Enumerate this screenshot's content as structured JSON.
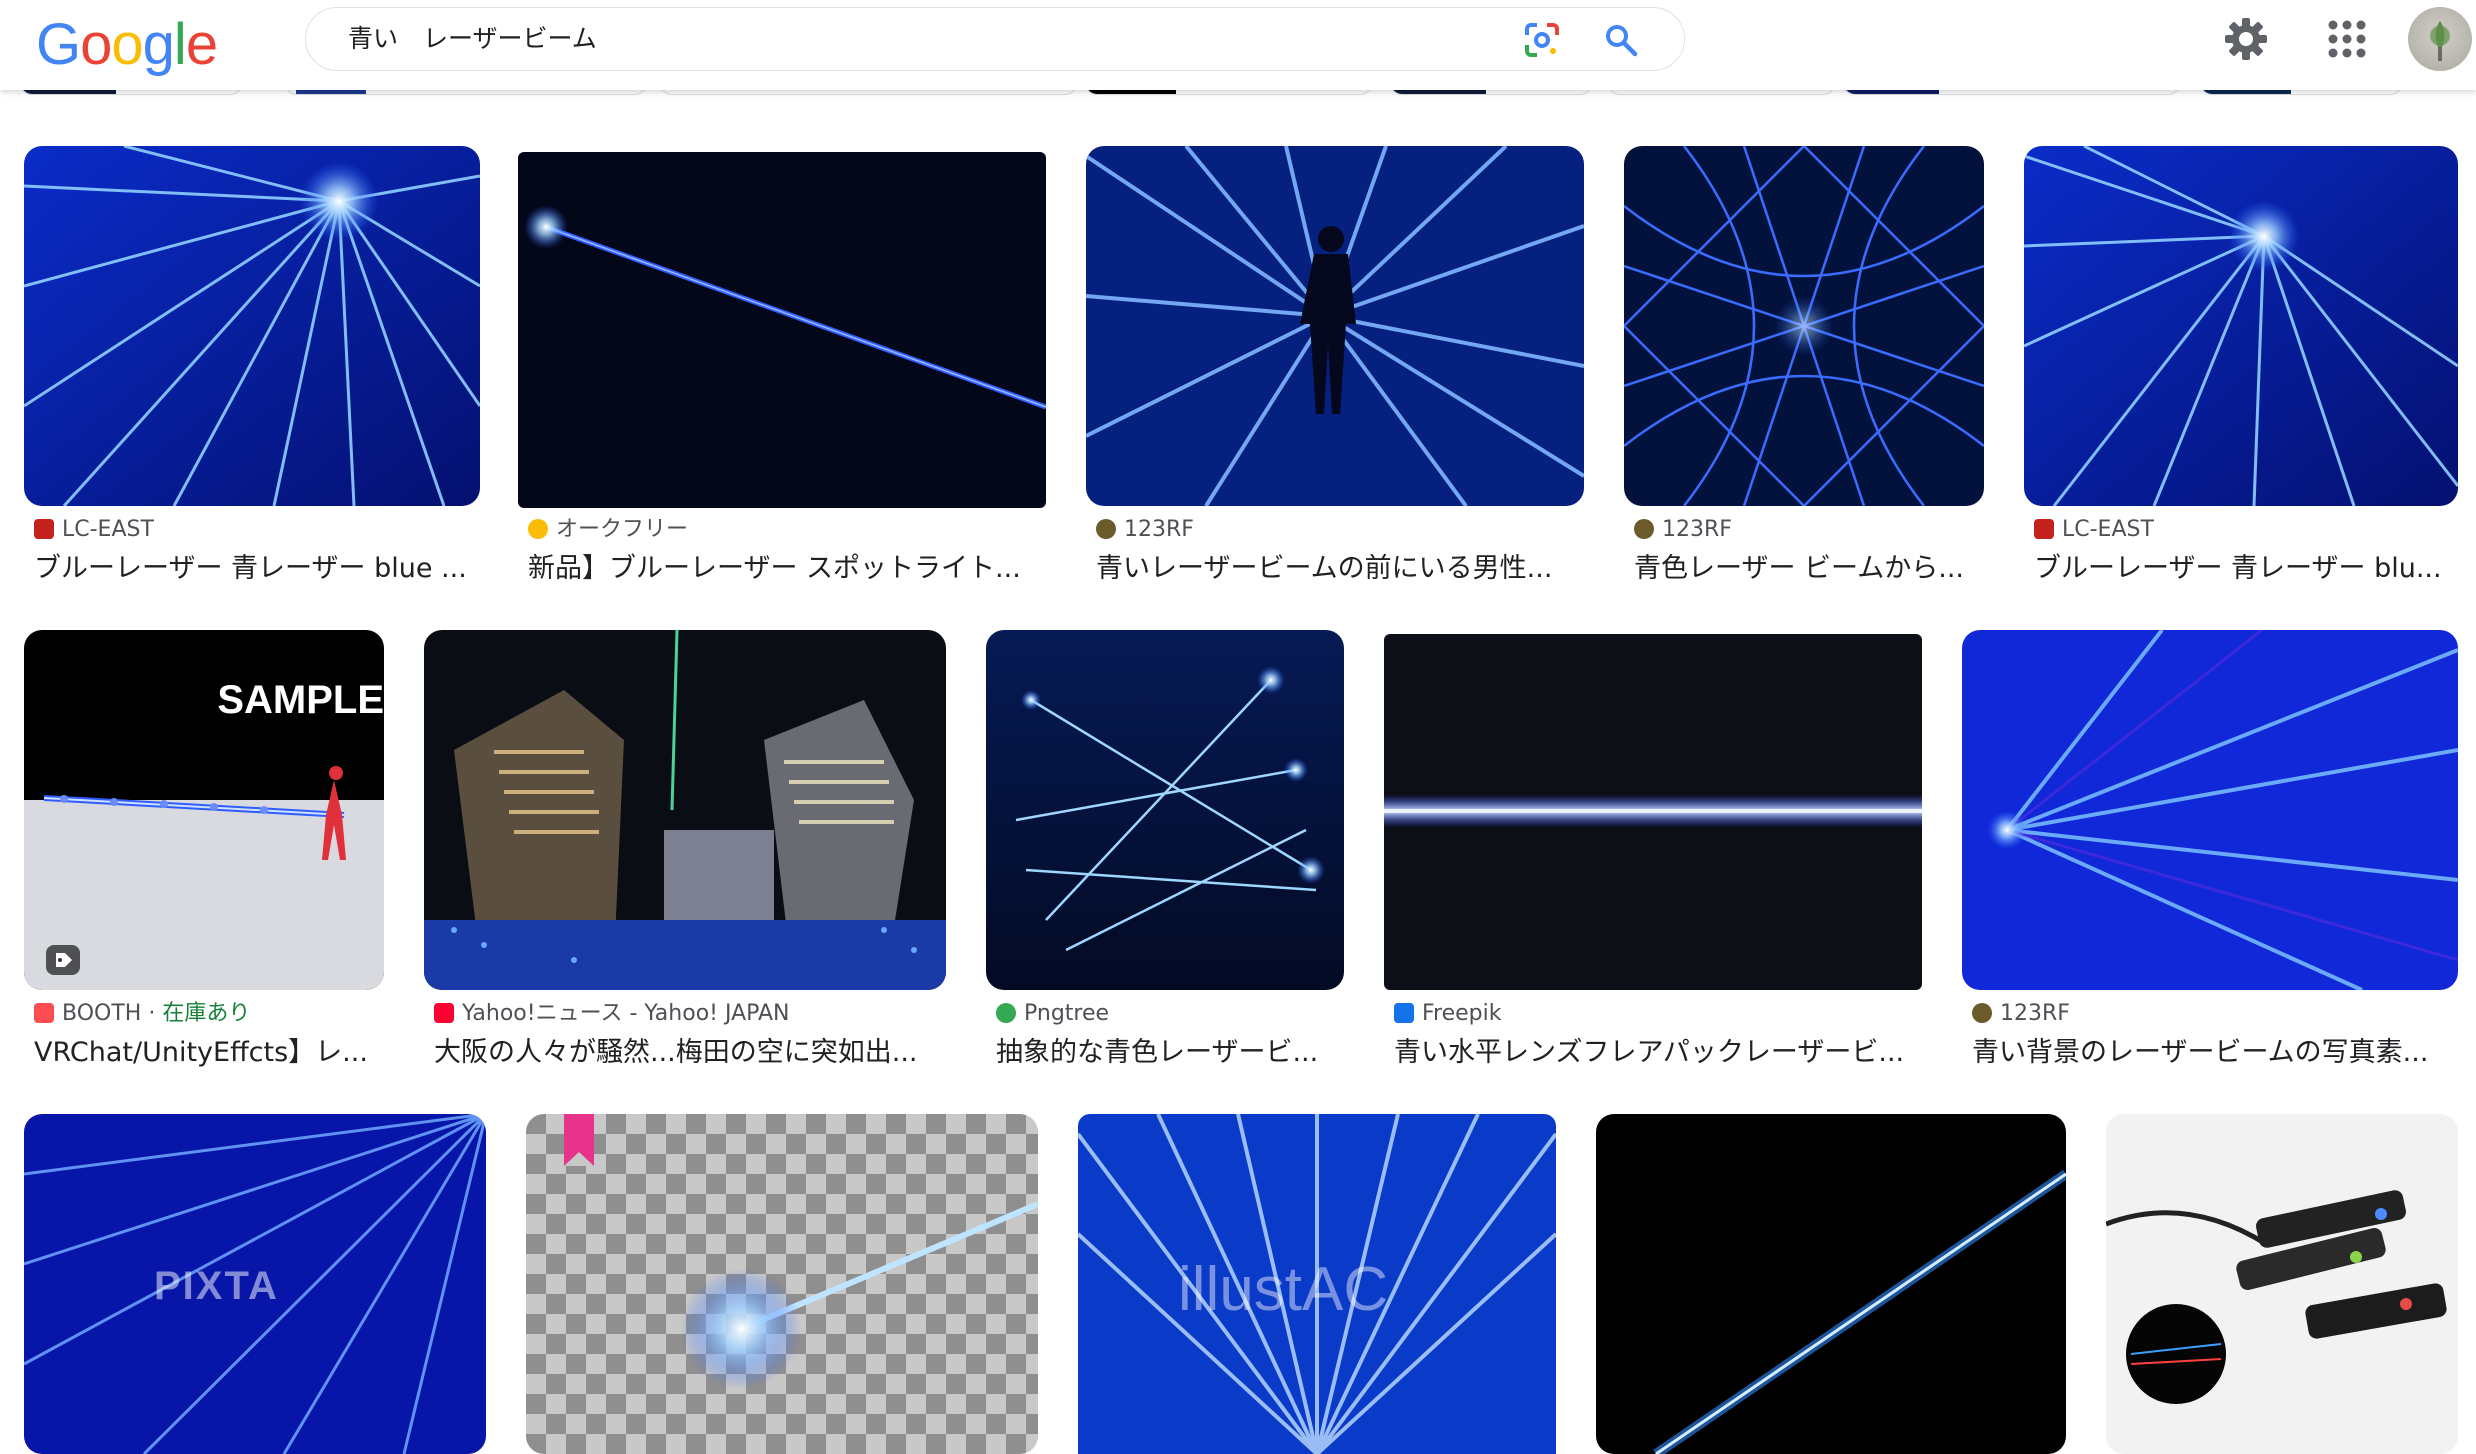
{
  "header": {
    "logo_text": "Google",
    "search_query": "青い　レーザービーム",
    "lens_icon": "google-lens-icon",
    "search_icon": "magnifier-icon",
    "settings_icon": "gear-icon",
    "apps_icon": "apps-grid-icon"
  },
  "results": [
    {
      "source": "LC-EAST",
      "title": "ブルーレーザー 青レーザー blue ...",
      "favicon": "lc-east-icon",
      "favicon_color": "#c5221f"
    },
    {
      "source": "オークフリー",
      "title": "新品】ブルーレーザー スポットライト...",
      "favicon": "oakfree-icon",
      "favicon_color": "#9aa0a6"
    },
    {
      "source": "123RF",
      "title": "青いレーザービームの前にいる男性...",
      "favicon": "123rf-icon",
      "favicon_color": "#6b5a2a"
    },
    {
      "source": "123RF",
      "title": "青色レーザー ビームから...",
      "favicon": "123rf-icon",
      "favicon_color": "#6b5a2a"
    },
    {
      "source": "LC-EAST",
      "title": "ブルーレーザー 青レーザー blu...",
      "favicon": "lc-east-icon",
      "favicon_color": "#c5221f"
    },
    {
      "source": "BOOTH · ",
      "stock": "在庫あり",
      "title": "VRChat/UnityEffcts】レ...",
      "favicon": "booth-icon",
      "favicon_color": "#fc4d50",
      "overlay_text": "SAMPLE"
    },
    {
      "source": "Yahoo!ニュース - Yahoo! JAPAN",
      "title": "大阪の人々が騒然...梅田の空に突如出...",
      "favicon": "yahoo-icon",
      "favicon_color": "#ff0033"
    },
    {
      "source": "Pngtree",
      "title": "抽象的な青色レーザービ...",
      "favicon": "pngtree-icon",
      "favicon_color": "#34a853"
    },
    {
      "source": "Freepik",
      "title": "青い水平レンズフレアパックレーザービ...",
      "favicon": "freepik-icon",
      "favicon_color": "#1273eb"
    },
    {
      "source": "123RF",
      "title": "青い背景のレーザービームの写真素...",
      "favicon": "123rf-icon",
      "favicon_color": "#6b5a2a"
    }
  ],
  "row3": [
    {
      "watermark": "PIXTA"
    },
    {
      "watermark": ""
    },
    {
      "watermark": "illustAC"
    },
    {
      "watermark": ""
    },
    {
      "watermark": ""
    }
  ]
}
